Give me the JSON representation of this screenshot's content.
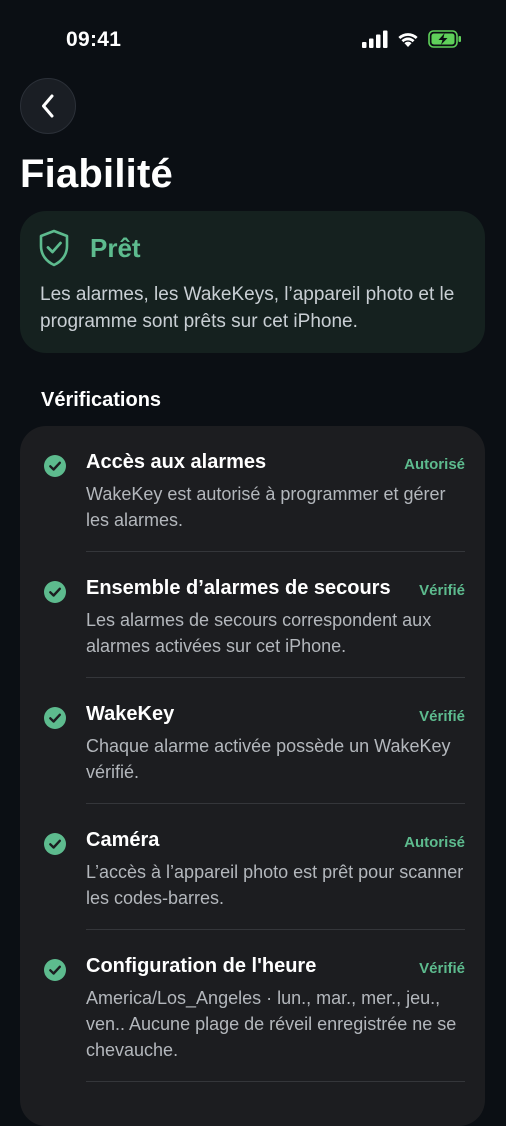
{
  "status_bar": {
    "time": "09:41"
  },
  "header": {
    "back_icon": "chevron-left-icon",
    "title": "Fiabilité"
  },
  "status_card": {
    "icon": "shield-check-icon",
    "label": "Prêt",
    "description": "Les alarmes, les WakeKeys, l’appareil photo et le programme sont prêts sur cet iPhone."
  },
  "checks_section": {
    "title": "Vérifications",
    "items": [
      {
        "title": "Accès aux alarmes",
        "status": "Autorisé",
        "description": "WakeKey est autorisé à programmer et gérer les alarmes."
      },
      {
        "title": "Ensemble d’alarmes de secours",
        "status": "Vérifié",
        "description": "Les alarmes de secours correspondent aux alarmes activées sur cet iPhone."
      },
      {
        "title": "WakeKey",
        "status": "Vérifié",
        "description": "Chaque alarme activée possède un WakeKey vérifié."
      },
      {
        "title": "Caméra",
        "status": "Autorisé",
        "description": "L’accès à l’appareil photo est prêt pour scanner les codes-barres."
      },
      {
        "title": "Configuration de l'heure",
        "status": "Vérifié",
        "description": "America/Los_Angeles · lun., mar., mer., jeu., ven.. Aucune plage de réveil enregistrée ne se chevauche."
      }
    ]
  },
  "colors": {
    "accent_green": "#5dbb8e",
    "background": "#0b0f14",
    "card": "#1c1d20",
    "status_card": "#15211f"
  }
}
